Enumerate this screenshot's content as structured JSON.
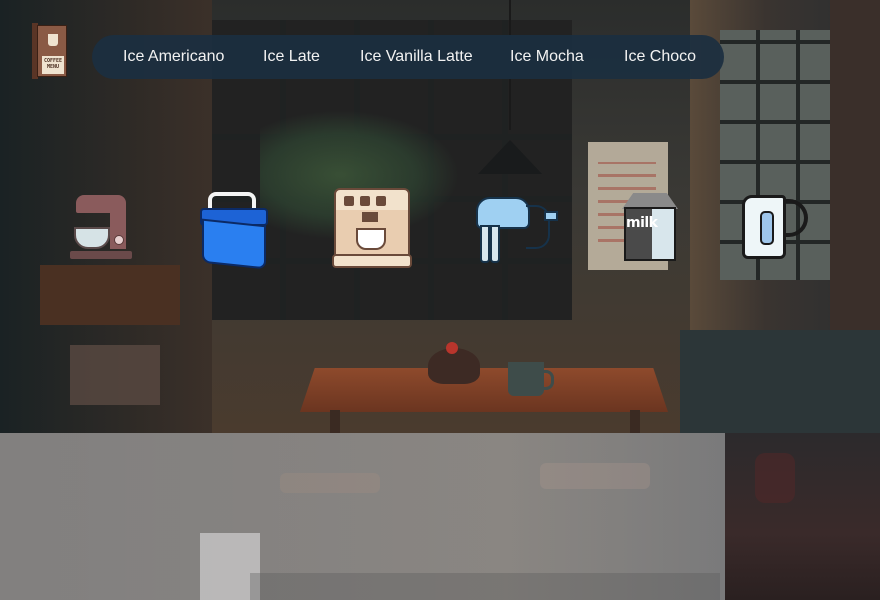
{
  "menu_book": {
    "icon": "coffee-menu-book-icon",
    "label_line1": "COFFEE",
    "label_line2": "MENU"
  },
  "nav": {
    "items": [
      {
        "label": "Ice Americano"
      },
      {
        "label": "Ice Late"
      },
      {
        "label": "Ice Vanilla Latte"
      },
      {
        "label": "Ice Mocha"
      },
      {
        "label": "Ice Choco"
      }
    ],
    "background": "#1b2f40",
    "text_color": "#f2f2f2"
  },
  "equipment": [
    {
      "name": "stand-mixer",
      "icon": "stand-mixer-icon"
    },
    {
      "name": "ice-cooler",
      "icon": "ice-cooler-icon"
    },
    {
      "name": "espresso-machine",
      "icon": "espresso-machine-icon"
    },
    {
      "name": "hand-mixer",
      "icon": "hand-mixer-icon"
    },
    {
      "name": "milk-carton",
      "icon": "milk-carton-icon",
      "label": "milk"
    },
    {
      "name": "kettle",
      "icon": "kettle-icon"
    }
  ]
}
